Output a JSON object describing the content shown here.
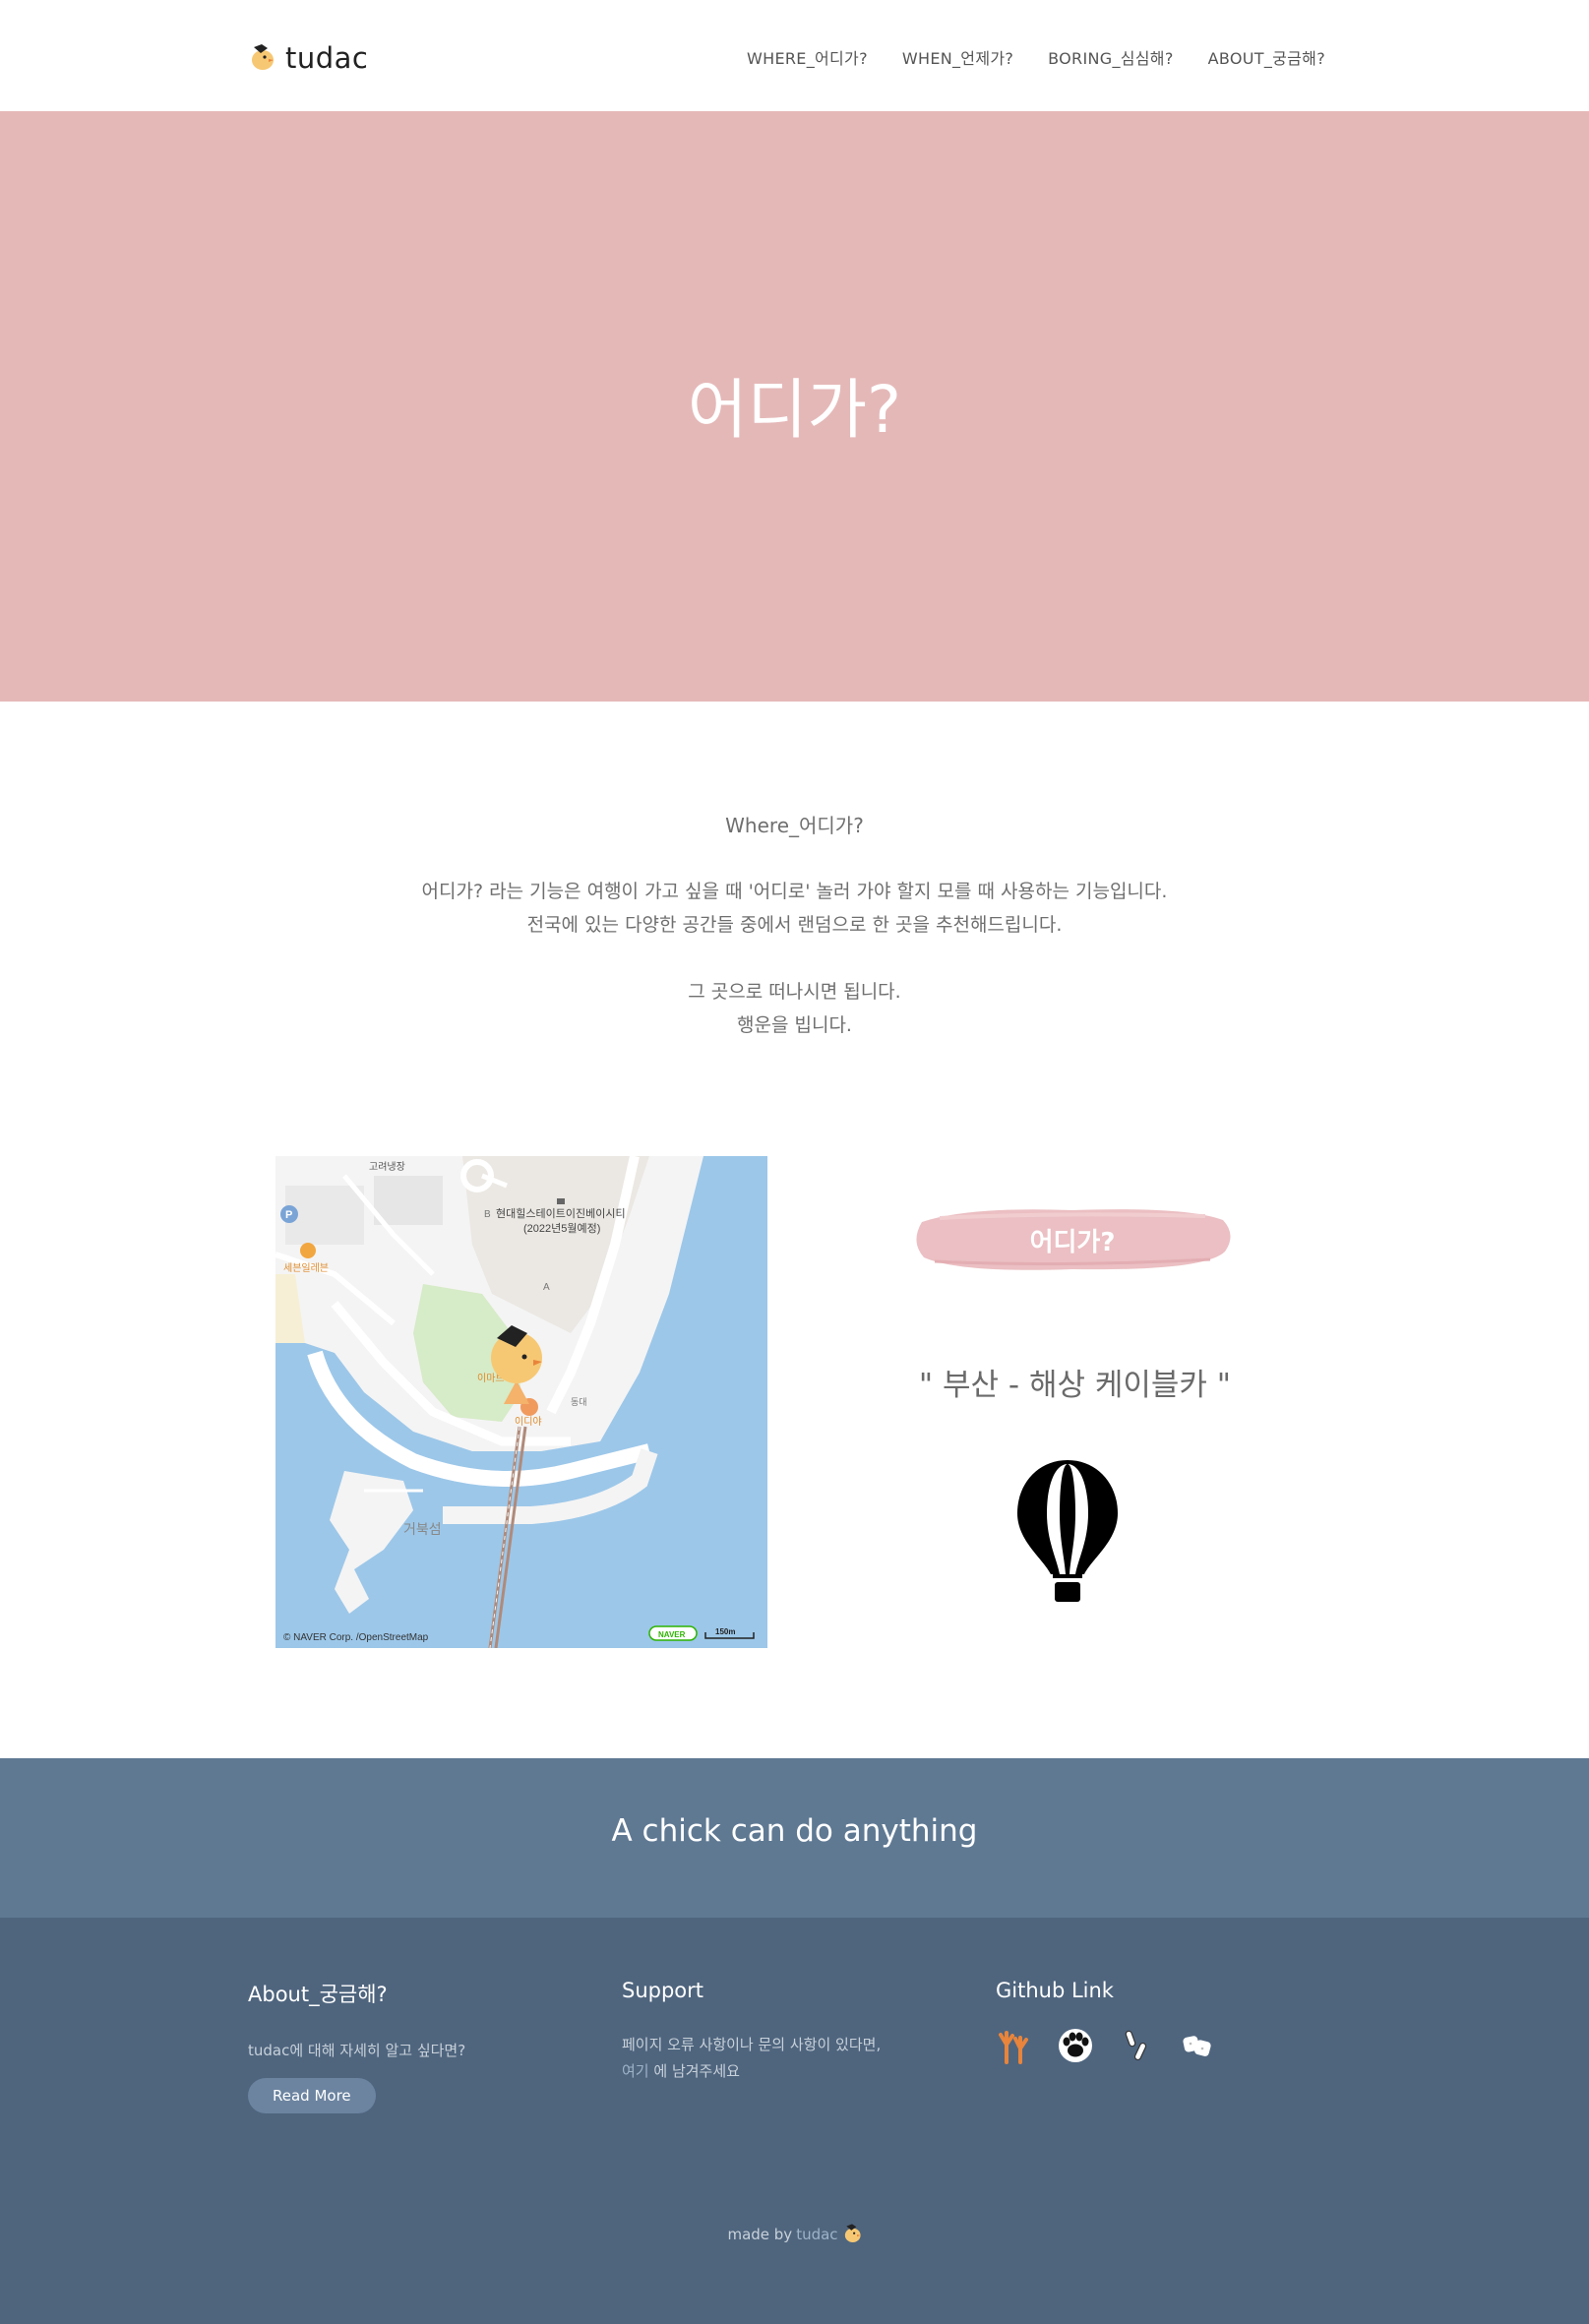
{
  "header": {
    "logo_text": "tudac",
    "nav": [
      {
        "label": "WHERE_어디가?"
      },
      {
        "label": "WHEN_언제가?"
      },
      {
        "label": "BORING_심심해?"
      },
      {
        "label": "ABOUT_궁금해?"
      }
    ]
  },
  "hero": {
    "title": "어디가?"
  },
  "intro": {
    "subtitle": "Where_어디가?",
    "line1": "어디가? 라는 기능은 여행이 가고 싶을 때 '어디로' 놀러 가야 할지 모를 때 사용하는 기능입니다.",
    "line2": "전국에 있는 다양한 공간들 중에서 랜덤으로 한 곳을 추천해드립니다.",
    "line3": "그 곳으로 떠나시면 됩니다.",
    "line4": "행운을 빕니다."
  },
  "map": {
    "labels": {
      "top": "고려냉장",
      "building": "현대힐스테이트이진베이시티",
      "building_sub": "(2022년5월예정)",
      "store": "세븐일레븐",
      "emart": "이마트",
      "cafe": "이디야",
      "island": "거북섬",
      "east": "동대",
      "a_marker": "A",
      "b_marker": "B",
      "parking": "P"
    },
    "copyright": "© NAVER Corp. /OpenStreetMap",
    "naver_badge": "NAVER",
    "scale": "150m"
  },
  "result": {
    "button_label": "어디가?",
    "place": "\" 부산 - 해상 케이블카 \""
  },
  "banner": {
    "text": "A chick can do anything"
  },
  "footer": {
    "about": {
      "title": "About_궁금해?",
      "text": "tudac에 대해 자세히 알고 싶다면?",
      "button": "Read More"
    },
    "support": {
      "title": "Support",
      "line1": "페이지 오류 사항이나 문의 사항이 있다면,",
      "link": "여기",
      "line2_rest": " 에 남겨주세요"
    },
    "github": {
      "title": "Github Link",
      "icons": [
        "chick-feet-icon",
        "paw-icon",
        "bandage-icon",
        "dice-icon"
      ]
    },
    "madeby": {
      "prefix": "made by",
      "link": "tudac"
    }
  },
  "colors": {
    "hero_bg": "#e5b8b8",
    "banner_bg": "#5f7993",
    "footer_bg": "#4f657e",
    "brush": "#eabcc0"
  }
}
